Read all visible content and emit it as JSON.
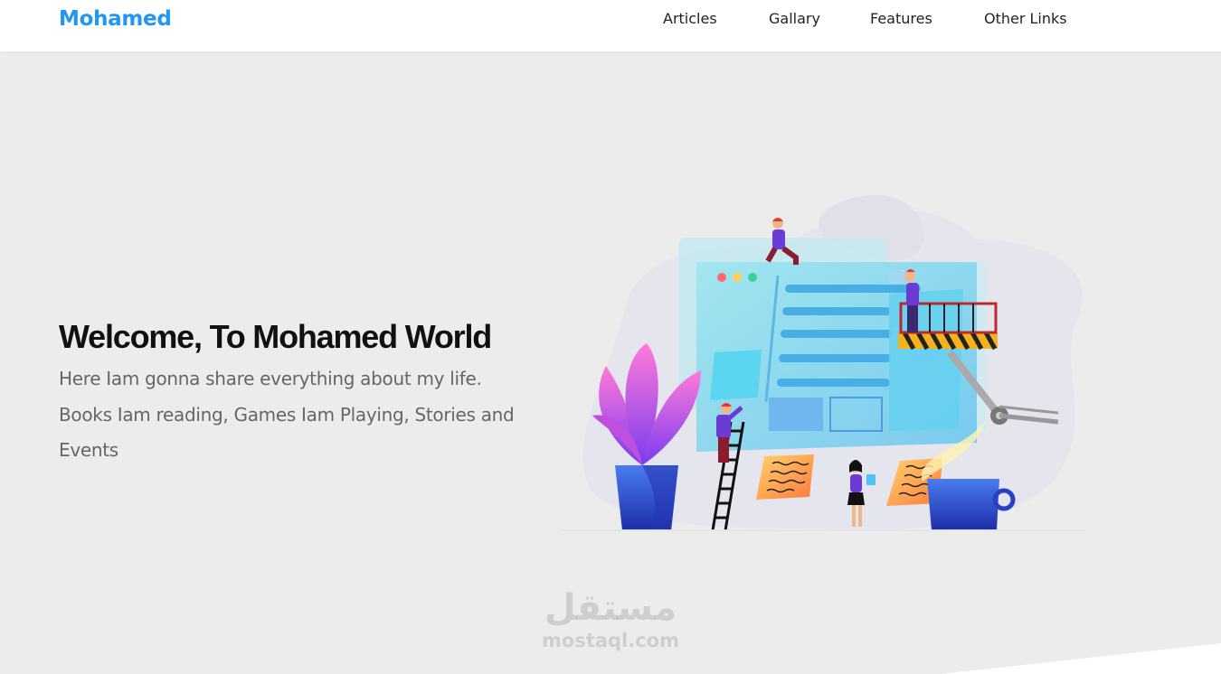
{
  "header": {
    "logo": "Mohamed",
    "nav": [
      "Articles",
      "Gallary",
      "Features",
      "Other Links"
    ]
  },
  "hero": {
    "title": "Welcome, To Mohamed World",
    "description": "Here Iam gonna share everything about my life. Books Iam reading, Games Iam Playing, Stories and Events"
  },
  "watermark": {
    "arabic": "مستقل",
    "latin": "mostaql.com"
  },
  "colors": {
    "brand": "#2196f3",
    "background": "#ececec",
    "heading": "#111111",
    "body_text": "#666666"
  },
  "icons": [
    "web-development-illustration"
  ]
}
